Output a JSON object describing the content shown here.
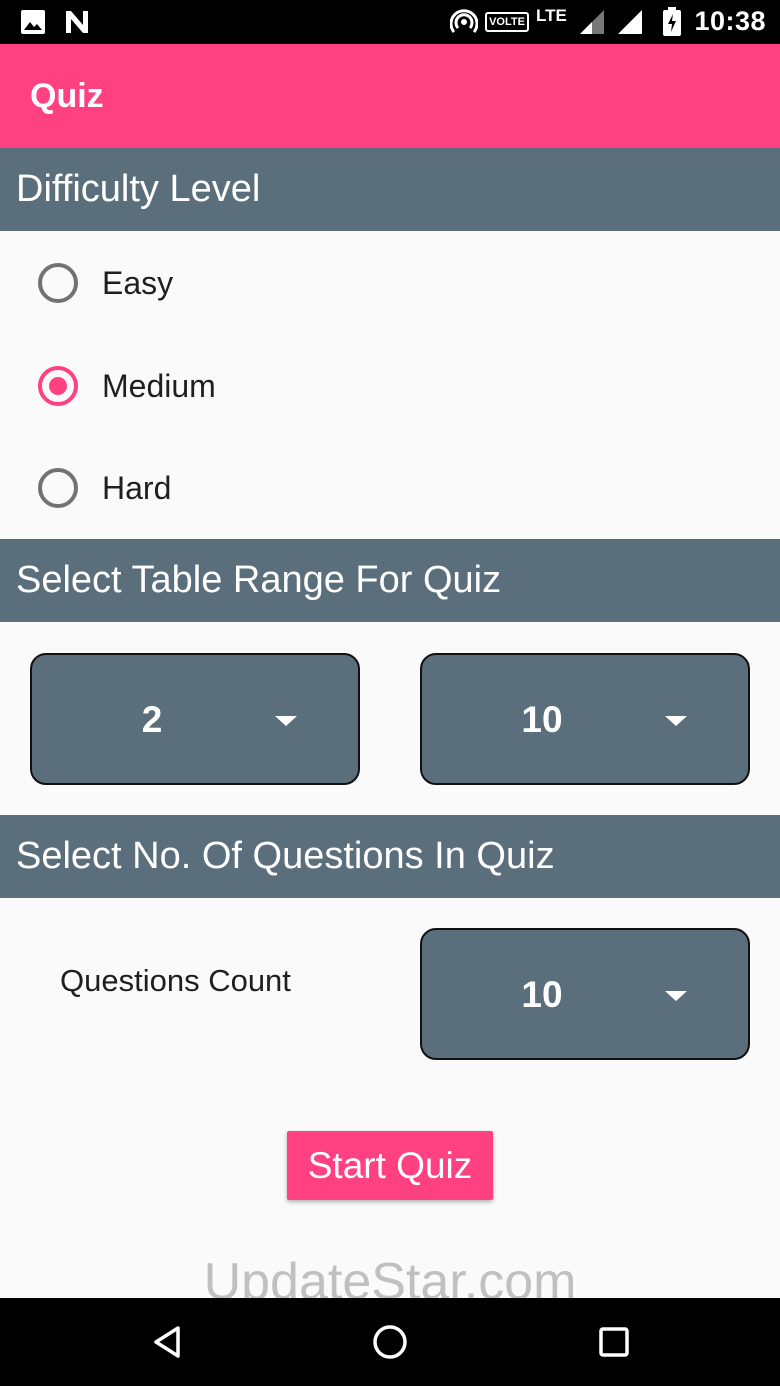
{
  "status_bar": {
    "time": "10:38",
    "volte": "VOLTE",
    "network": "LTE",
    "icons": [
      "gallery-icon",
      "n-notification-icon",
      "hotspot-icon",
      "volte-icon",
      "lte-signal-icon",
      "wifi-signal-icon",
      "battery-charging-icon"
    ]
  },
  "app_bar": {
    "title": "Quiz"
  },
  "difficulty": {
    "header": "Difficulty Level",
    "options": [
      {
        "label": "Easy",
        "checked": false
      },
      {
        "label": "Medium",
        "checked": true
      },
      {
        "label": "Hard",
        "checked": false
      }
    ]
  },
  "table_range": {
    "header": "Select Table Range For Quiz",
    "from_value": "2",
    "to_value": "10"
  },
  "questions": {
    "header": "Select No. Of Questions In Quiz",
    "label": "Questions Count",
    "count_value": "10"
  },
  "start_button": "Start Quiz",
  "watermark": "UpdateStar.com",
  "nav_bar": {
    "icons": [
      "back-icon",
      "home-icon",
      "recents-icon"
    ]
  },
  "colors": {
    "accent": "#ff4081",
    "section": "#5a6e7b",
    "background": "#fafafa"
  }
}
